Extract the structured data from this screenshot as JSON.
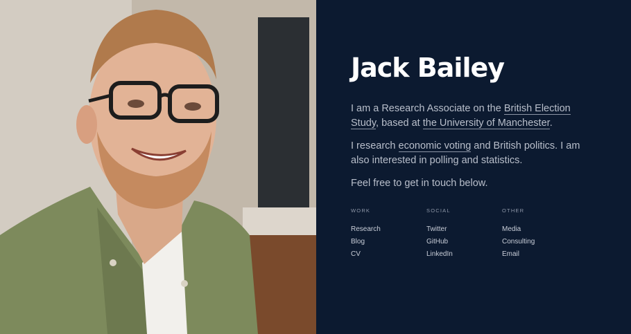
{
  "profile": {
    "name": "Jack Bailey",
    "photo_alt": "Portrait of Jack Bailey"
  },
  "bio": {
    "p1_text1": "I am a Research Associate on the ",
    "p1_link1": "British Election Study",
    "p1_text2": ", based at ",
    "p1_link2": "the University of Manchester",
    "p1_text3": ".",
    "p2_text1": "I research ",
    "p2_link1": "economic voting",
    "p2_text2": " and British politics. I am also interested in polling and statistics.",
    "p3": "Feel free to get in touch below."
  },
  "links": {
    "work": {
      "heading": "WORK",
      "items": [
        "Research",
        "Blog",
        "CV"
      ]
    },
    "social": {
      "heading": "SOCIAL",
      "items": [
        "Twitter",
        "GitHub",
        "LinkedIn"
      ]
    },
    "other": {
      "heading": "OTHER",
      "items": [
        "Media",
        "Consulting",
        "Email"
      ]
    }
  },
  "colors": {
    "panel_background": "#0c1a30",
    "heading": "#ffffff",
    "body_text": "#b9bfcb"
  }
}
